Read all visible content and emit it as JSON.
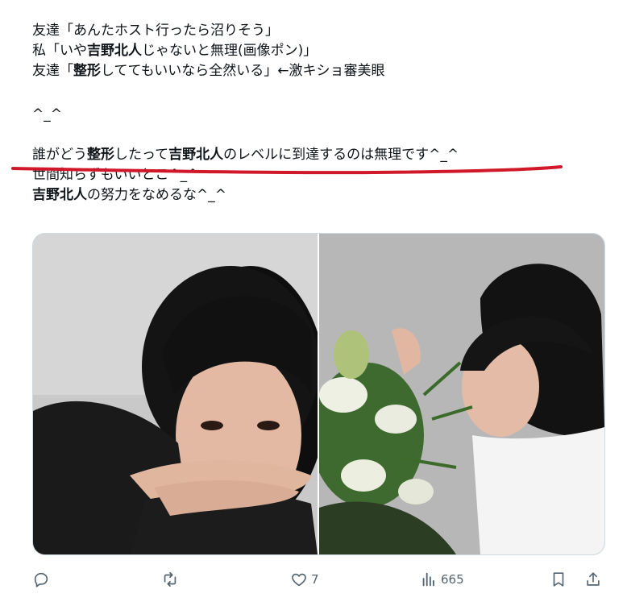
{
  "tweet": {
    "lines": [
      {
        "segments": [
          {
            "text": "友達「あんたホスト行ったら沼りそう」",
            "bold": false
          }
        ]
      },
      {
        "segments": [
          {
            "text": "私「いや",
            "bold": false
          },
          {
            "text": "吉野北人",
            "bold": true
          },
          {
            "text": "じゃないと無理(画像ポン)」",
            "bold": false
          }
        ]
      },
      {
        "segments": [
          {
            "text": "友達「",
            "bold": false
          },
          {
            "text": "整形",
            "bold": true
          },
          {
            "text": "しててもいいなら全然いる」←激キショ審美眼",
            "bold": false
          }
        ]
      },
      {
        "segments": [
          {
            "text": "^_^",
            "bold": false
          }
        ]
      },
      {
        "segments": [
          {
            "text": "誰がどう",
            "bold": false
          },
          {
            "text": "整形",
            "bold": true
          },
          {
            "text": "したって",
            "bold": false
          },
          {
            "text": "吉野北人",
            "bold": true
          },
          {
            "text": "のレベルに到達するのは無理です^_^",
            "bold": false
          }
        ]
      },
      {
        "segments": [
          {
            "text": "世間知らずもいいとこ^_^",
            "bold": false
          }
        ]
      },
      {
        "segments": [
          {
            "text": "吉野北人",
            "bold": true
          },
          {
            "text": "の努力をなめるな^_^",
            "bold": false
          }
        ]
      }
    ]
  },
  "annotation": {
    "color": "#d0182a"
  },
  "media": {
    "left_image": {
      "description_icon": "portrait-photo-icon"
    },
    "right_image": {
      "description_icon": "portrait-with-flowers-photo-icon"
    }
  },
  "actions": {
    "reply": {
      "icon": "reply-icon",
      "count": ""
    },
    "retweet": {
      "icon": "retweet-icon",
      "count": ""
    },
    "like": {
      "icon": "heart-icon",
      "count": "7"
    },
    "views": {
      "icon": "views-chart-icon",
      "count": "665"
    },
    "bookmark": {
      "icon": "bookmark-icon"
    },
    "share": {
      "icon": "share-icon"
    }
  },
  "colors": {
    "text": "#0f1419",
    "muted": "#536471",
    "border": "#cfd9de"
  }
}
